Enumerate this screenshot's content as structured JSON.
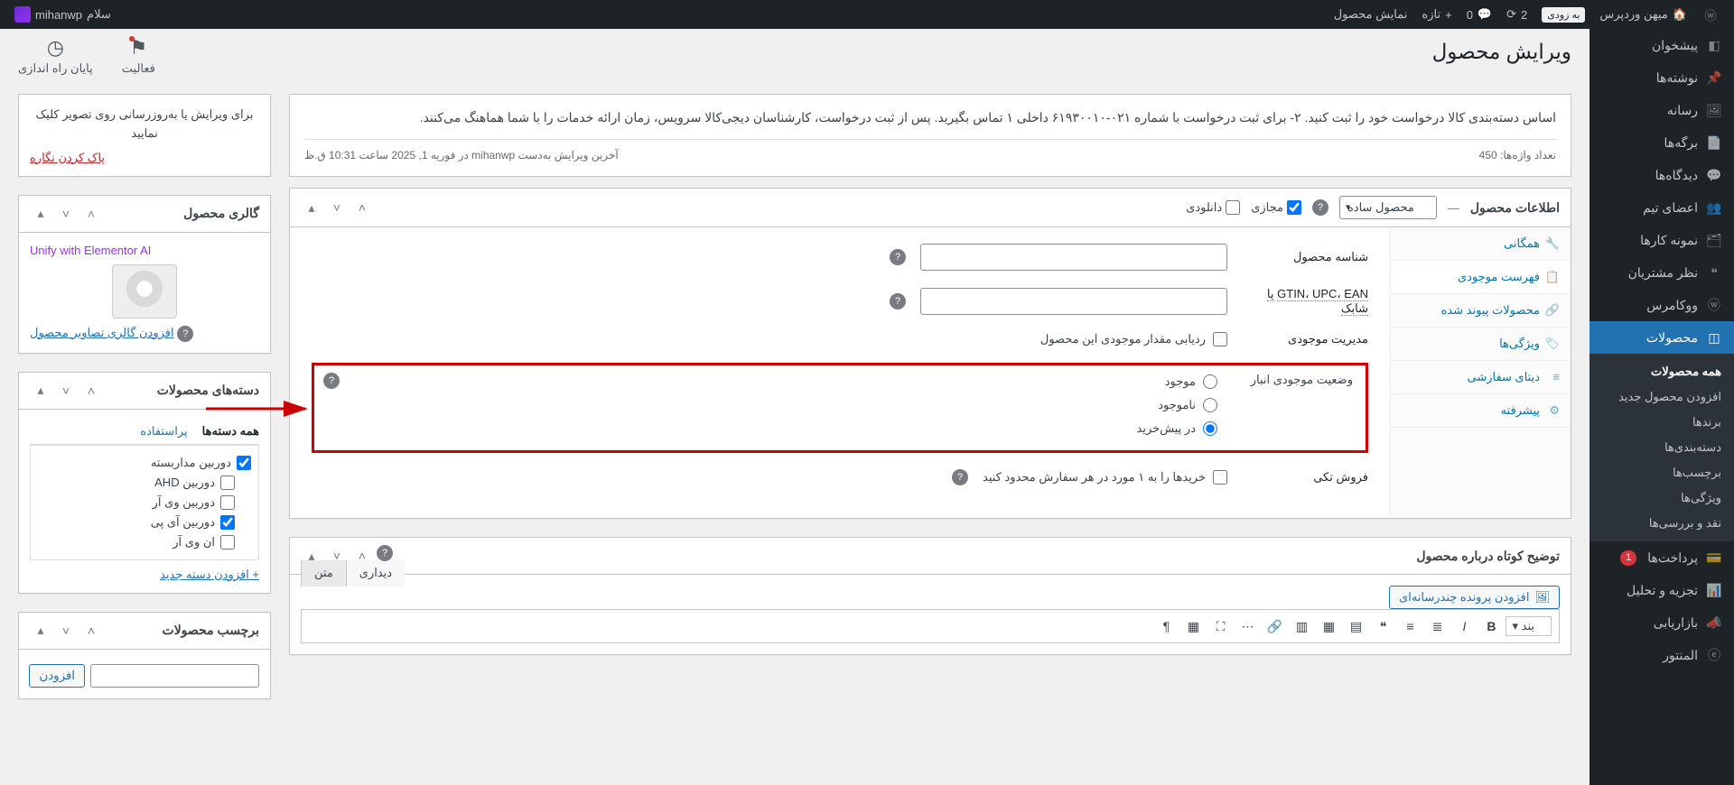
{
  "adminbar": {
    "site_name": "میهن وردپرس",
    "soon_badge": "به زودی",
    "updates_count": "2",
    "comments_count": "0",
    "new_label": "تازه",
    "view_product": "نمایش محصول",
    "howdy": "سلام",
    "username": "mihanwp"
  },
  "sidebar": {
    "items": [
      {
        "label": "پیشخوان",
        "icon": "dashboard"
      },
      {
        "label": "نوشته‌ها",
        "icon": "pin"
      },
      {
        "label": "رسانه",
        "icon": "media"
      },
      {
        "label": "برگه‌ها",
        "icon": "pages"
      },
      {
        "label": "دیدگاه‌ها",
        "icon": "comments"
      },
      {
        "label": "اعضای تیم",
        "icon": "team"
      },
      {
        "label": "نمونه کارها",
        "icon": "portfolio"
      },
      {
        "label": "نظر مشتریان",
        "icon": "quote"
      },
      {
        "label": "ووکامرس",
        "icon": "woo"
      }
    ],
    "products_label": "محصولات",
    "products_sub": [
      "همه محصولات",
      "افزودن محصول جدید",
      "برندها",
      "دسته‌بندی‌ها",
      "برچسب‌ها",
      "ویژگی‌ها",
      "نقد و بررسی‌ها"
    ],
    "after": [
      {
        "label": "پرداخت‌ها",
        "badge": "1"
      },
      {
        "label": "تجزیه و تحلیل"
      },
      {
        "label": "بازاریابی"
      },
      {
        "label": "المنتور"
      }
    ]
  },
  "page": {
    "title": "ویرایش محصول",
    "top_tabs": {
      "activity": "فعالیت",
      "setup": "پایان راه اندازی"
    },
    "desc_text": "اساس دسته‌بندی کالا درخواست خود را ثبت کنید. ۲- برای ثبت درخواست با شماره ۰۲۱-۶۱۹۳۰۰۱۰ داخلی ۱ تماس بگیرید. پس از ثبت درخواست، کارشناسان دیجی‌کالا سرویس، زمان ارائه خدمات را با شما هماهنگ می‌کنند.",
    "word_count_label": "تعداد واژه‌ها:",
    "word_count": "450",
    "last_edit": "آخرین ویرایش به‌دست mihanwp در فوریه 1, 2025 ساعت 10:31 ق.ظ"
  },
  "thumb_box": {
    "note": "برای ویرایش یا به‌روزرسانی روی تصویر کلیک نمایید",
    "remove_link": "پاک کردن نگاره"
  },
  "gallery_box": {
    "title": "گالری محصول",
    "elementor_link": "Unify with Elementor AI",
    "add_link": "افزودن گالری تصاویر محصول"
  },
  "cat_box": {
    "title": "دسته‌های محصولات",
    "tab_all": "همه دسته‌ها",
    "tab_used": "پراستفاده",
    "cats": [
      {
        "label": "دوربین مداربسته",
        "checked": true
      },
      {
        "label": "دوربین AHD",
        "checked": false
      },
      {
        "label": "دوربین وی آر",
        "checked": false
      },
      {
        "label": "دوربین آی پی",
        "checked": true
      },
      {
        "label": "ان وی آر",
        "checked": false
      }
    ],
    "add_new": "+ افزودن دسته جدید"
  },
  "tag_box": {
    "title": "برچسب محصولات",
    "btn": "افزودن"
  },
  "product_data": {
    "title": "اطلاعات محصول",
    "type_selected": "محصول ساده",
    "virtual_label": "مجازی",
    "download_label": "دانلودی",
    "tabs": {
      "general": "همگانی",
      "inventory": "فهرست موجودی",
      "linked": "محصولات پیوند شده",
      "attributes": "ویژگی‌ها",
      "custom": "دیتای سفارشی",
      "advanced": "پیشرفته"
    },
    "fields": {
      "sku_label": "شناسه محصول",
      "gtin_label": "GTIN، UPC، EAN",
      "gtin_or": "یا شابک",
      "manage_label": "مدیریت موجودی",
      "manage_check": "ردیابی مقدار موجودی این محصول",
      "stock_status_label": "وضعیت موجودی انبار",
      "status_in": "موجود",
      "status_out": "ناموجود",
      "status_backorder": "در پیش‌خرید",
      "sold_ind_label": "فروش تکی",
      "sold_ind_check": "خریدها را به ۱ مورد در هر سفارش محدود کنید"
    }
  },
  "short_desc": {
    "title": "توضیح کوتاه درباره محصول",
    "media_btn": "افزودن پرونده چندرسانه‌ای",
    "tab_visual": "دیداری",
    "tab_text": "متن",
    "format": "بند"
  }
}
